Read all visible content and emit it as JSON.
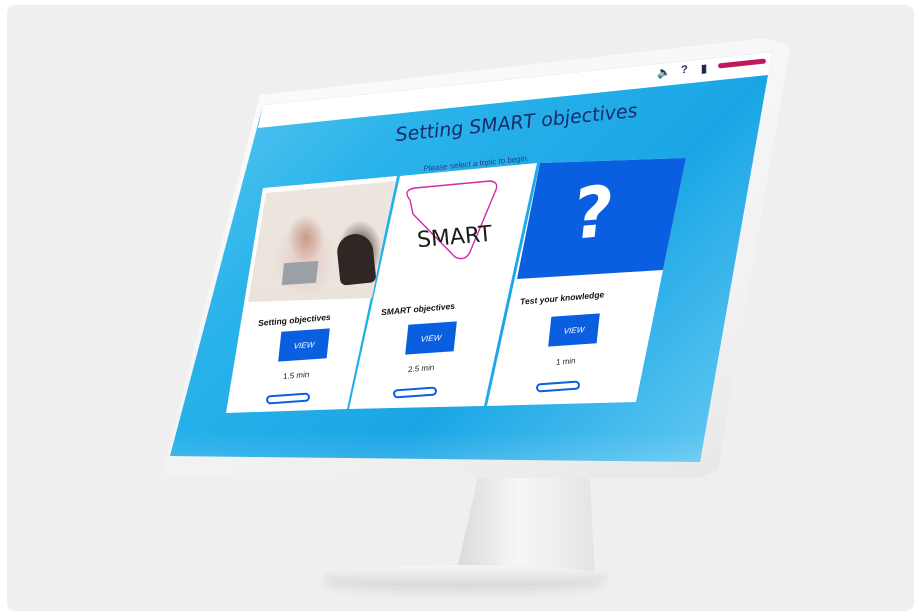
{
  "course": {
    "title": "Setting SMART objectives",
    "subtitle": "Please select a topic to begin."
  },
  "toolbar": {
    "audio_icon": "speaker-icon",
    "help_label": "?",
    "resources_icon": "document-icon",
    "menu_color": "#c2185b"
  },
  "topics": [
    {
      "label": "Setting objectives",
      "button": "VIEW",
      "duration": "1.5 min",
      "image": "photo of two women in meeting",
      "progress": 0
    },
    {
      "label": "SMART objectives",
      "button": "VIEW",
      "duration": "2.5 min",
      "image_text": "SMART",
      "progress": 0
    },
    {
      "label": "Test your knowledge",
      "button": "VIEW",
      "duration": "1 min",
      "image_text": "?",
      "progress": 0
    }
  ],
  "colors": {
    "accent": "#0a5fe0",
    "title": "#1b2a6e",
    "background_gradient": [
      "#8fdcf7",
      "#1aa6e6",
      "#cdeffb"
    ]
  }
}
